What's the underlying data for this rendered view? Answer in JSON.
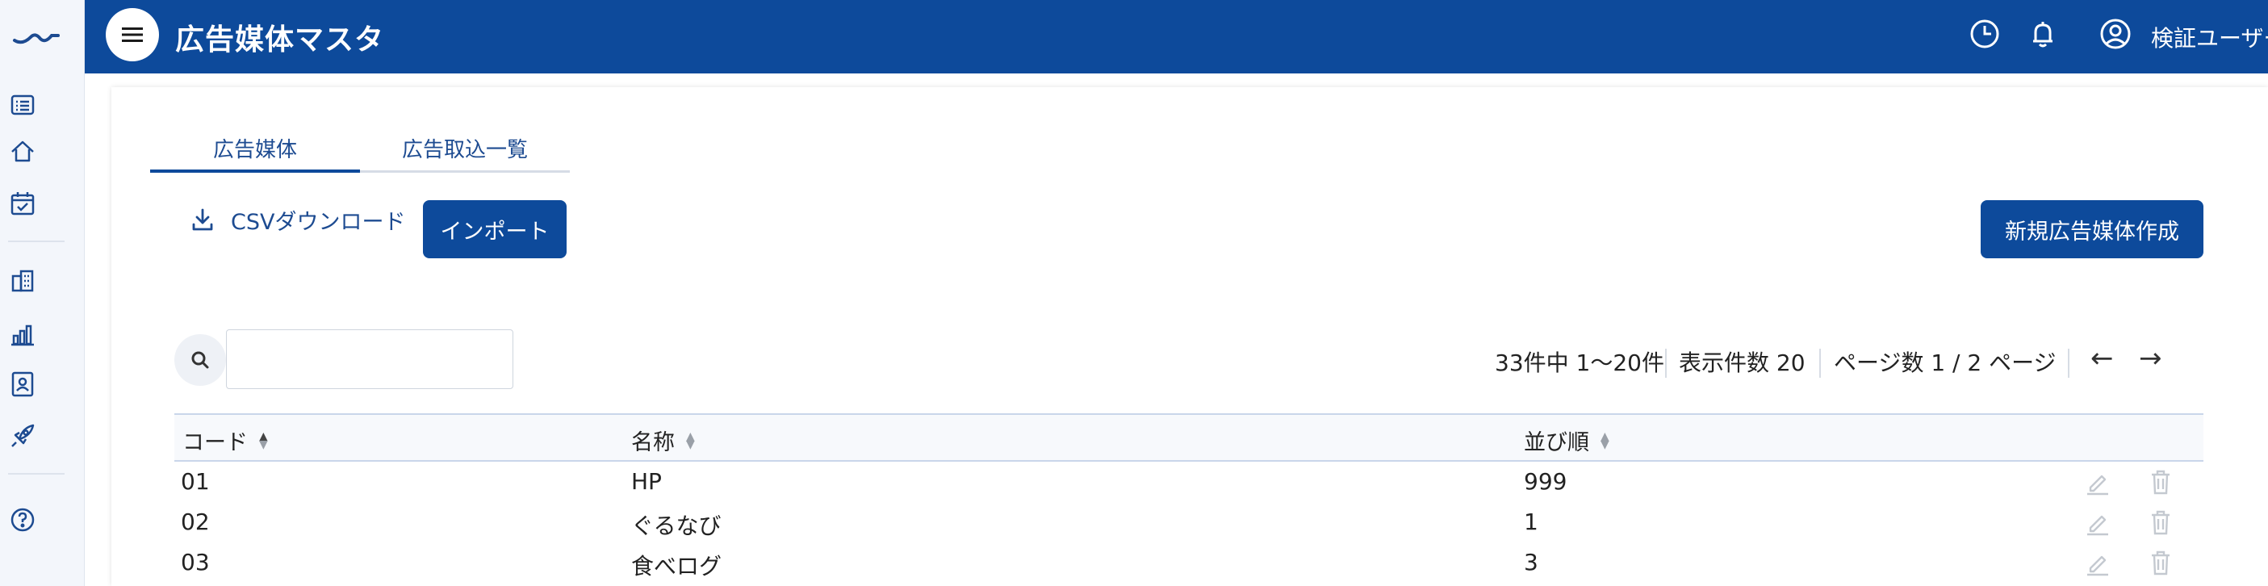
{
  "header": {
    "title": "広告媒体マスタ",
    "user_name": "検証ユーザー"
  },
  "tabs": [
    {
      "label": "広告媒体",
      "active": true
    },
    {
      "label": "広告取込一覧",
      "active": false
    }
  ],
  "toolbar": {
    "csv_label": "CSVダウンロード",
    "import_label": "インポート",
    "create_label": "新規広告媒体作成"
  },
  "search": {
    "value": "",
    "placeholder": ""
  },
  "pagination": {
    "range_text": "33件中 1〜20件",
    "page_size_text": "表示件数 20",
    "page_text": "ページ数 1 / 2 ページ",
    "prev_label": "←",
    "next_label": "→"
  },
  "table": {
    "columns": [
      {
        "label": "コード",
        "sort": "asc"
      },
      {
        "label": "名称",
        "sort": "none"
      },
      {
        "label": "並び順",
        "sort": "none"
      }
    ],
    "rows": [
      {
        "code": "01",
        "name": "HP",
        "order": "999"
      },
      {
        "code": "02",
        "name": "ぐるなび",
        "order": "1"
      },
      {
        "code": "03",
        "name": "食べログ",
        "order": "3"
      }
    ]
  },
  "icons": {
    "rail": [
      "list-icon",
      "home-icon",
      "calendar-check-icon",
      "building-icon",
      "bar-chart-icon",
      "contact-card-icon",
      "rocket-icon",
      "help-icon"
    ],
    "top": [
      "history-icon",
      "bell-icon",
      "user-circle-icon"
    ],
    "row_actions": [
      "edit-icon",
      "trash-icon"
    ]
  },
  "colors": {
    "brand": "#0d4a9b",
    "rail_bg": "#f3f6fb",
    "disabled_icon": "#c4c9d0"
  }
}
